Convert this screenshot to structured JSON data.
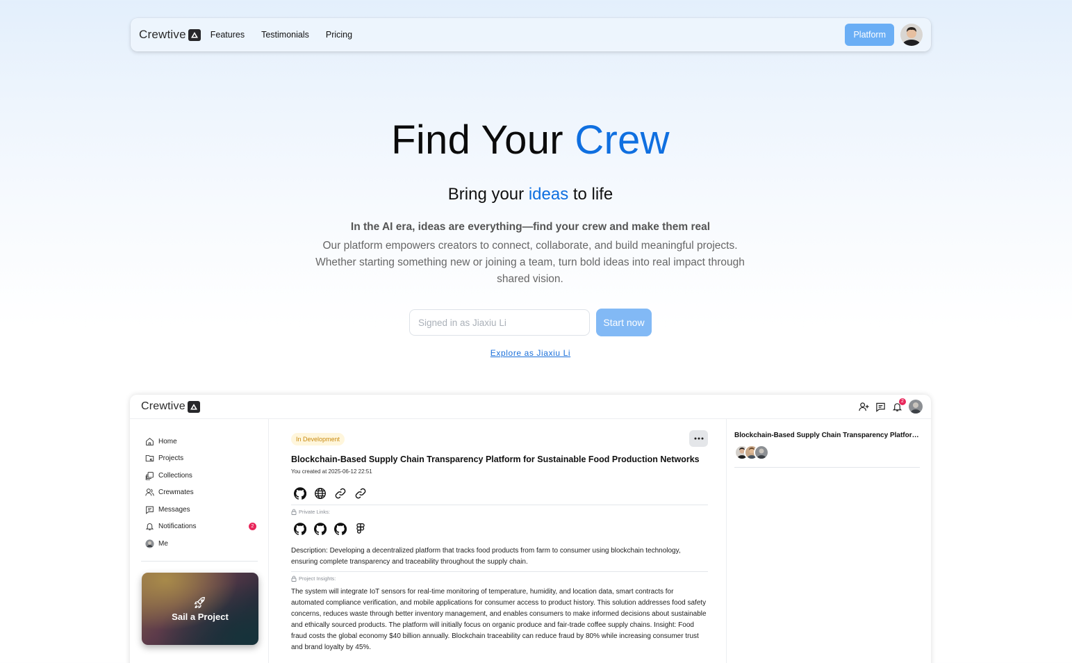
{
  "brand": {
    "name": "Crewtive"
  },
  "nav": {
    "links": [
      "Features",
      "Testimonials",
      "Pricing"
    ],
    "platform_label": "Platform"
  },
  "hero": {
    "title_part1": "Find Your ",
    "title_highlight": "Crew",
    "subtitle_part1": "Bring your ",
    "subtitle_highlight": "ideas",
    "subtitle_part2": " to life",
    "lead": "In the AI era, ideas are everything—find your crew and make them real",
    "description": "Our platform empowers creators to connect, collaborate, and build meaningful projects. Whether starting something new or joining a team, turn bold ideas into real impact through shared vision.",
    "input_placeholder": "Signed in as Jiaxiu Li",
    "start_label": "Start now",
    "explore_label": "Explore as Jiaxiu Li"
  },
  "app": {
    "topbar": {
      "notification_count": "2"
    },
    "sidebar": {
      "items": [
        {
          "label": "Home",
          "icon": "home-icon"
        },
        {
          "label": "Projects",
          "icon": "projects-icon"
        },
        {
          "label": "Collections",
          "icon": "collections-icon"
        },
        {
          "label": "Crewmates",
          "icon": "crewmates-icon"
        },
        {
          "label": "Messages",
          "icon": "messages-icon"
        },
        {
          "label": "Notifications",
          "icon": "bell-icon",
          "badge": "2"
        },
        {
          "label": "Me",
          "icon": "avatar"
        }
      ],
      "sail_label": "Sail a Project"
    },
    "project": {
      "status": "In Development",
      "title": "Blockchain-Based Supply Chain Transparency Platform for Sustainable Food Production Networks",
      "created": "You created at 2025-06-12 22:51",
      "public_links": [
        "github-icon",
        "globe-icon",
        "link-icon",
        "link-icon"
      ],
      "private_links_label": "Private Links:",
      "private_links": [
        "github-icon",
        "github-icon",
        "github-icon",
        "figma-icon"
      ],
      "description": "Description: Developing a decentralized platform that tracks food products from farm to consumer using blockchain technology, ensuring complete transparency and traceability throughout the supply chain.",
      "insights_label": "Project Insights:",
      "insights": "The system will integrate IoT sensors for real-time monitoring of temperature, humidity, and location data, smart contracts for automated compliance verification, and mobile applications for consumer access to product history. This solution addresses food safety concerns, reduces waste through better inventory management, and enables consumers to make informed decisions about sustainable and ethically sourced products. The platform will initially focus on organic produce and fair-trade coffee supply chains. Insight: Food fraud costs the global economy $40 billion annually. Blockchain traceability can reduce fraud by 80% while increasing consumer trust and brand loyalty by 45%."
    },
    "right_panel": {
      "title": "Blockchain-Based Supply Chain Transparency Platform for Sustainable Food Production Networks"
    }
  },
  "colors": {
    "accent": "#0f6fe0",
    "button": "#6aaef5",
    "badge": "#e8265a",
    "status_bg": "#fff6dc",
    "status_text": "#c88a10"
  }
}
